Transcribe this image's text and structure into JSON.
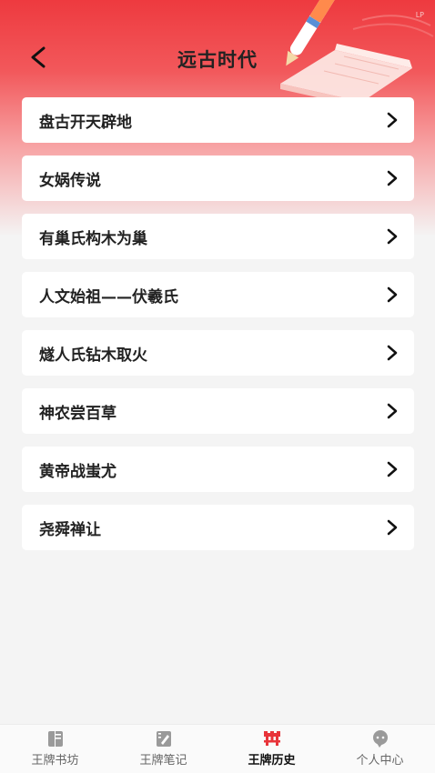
{
  "header": {
    "title": "远古时代",
    "watermark": "LP"
  },
  "items": [
    {
      "label": "盘古开天辟地"
    },
    {
      "label": "女娲传说"
    },
    {
      "label": "有巢氏构木为巢"
    },
    {
      "label": "人文始祖——伏羲氏"
    },
    {
      "label": "燧人氏钻木取火"
    },
    {
      "label": "神农尝百草"
    },
    {
      "label": "黄帝战蚩尤"
    },
    {
      "label": "尧舜禅让"
    }
  ],
  "tabs": [
    {
      "label": "王牌书坊",
      "icon": "book-icon",
      "active": false
    },
    {
      "label": "王牌笔记",
      "icon": "note-icon",
      "active": false
    },
    {
      "label": "王牌历史",
      "icon": "history-icon",
      "active": true
    },
    {
      "label": "个人中心",
      "icon": "profile-icon",
      "active": false
    }
  ],
  "colors": {
    "accent": "#e8343a",
    "inactive_icon": "#9a9a9a",
    "active_text": "#111111"
  }
}
